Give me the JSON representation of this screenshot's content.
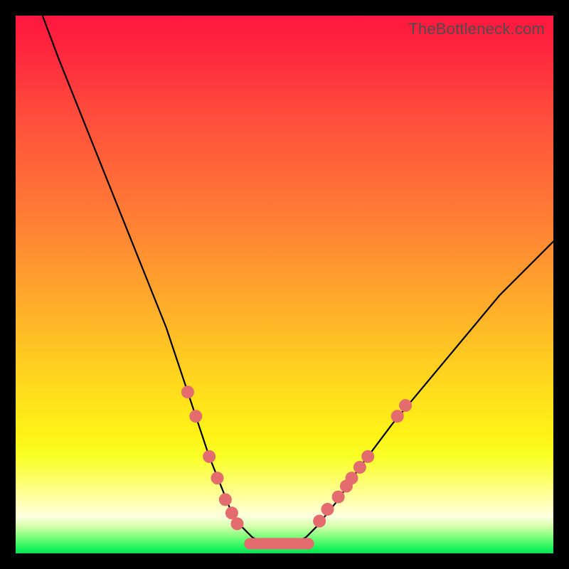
{
  "watermark": "TheBottleneck.com",
  "chart_data": {
    "type": "line",
    "title": "",
    "xlabel": "",
    "ylabel": "",
    "xlim": [
      0,
      100
    ],
    "ylim": [
      0,
      100
    ],
    "series": [
      {
        "name": "bottleneck-curve",
        "x": [
          5,
          8,
          12,
          16,
          20,
          24,
          28,
          30,
          32,
          34,
          36,
          38,
          40,
          42,
          44,
          46,
          48,
          50,
          52,
          54,
          56,
          60,
          64,
          70,
          80,
          90,
          100
        ],
        "y": [
          100,
          92,
          82,
          72,
          62,
          52,
          42,
          36,
          30,
          24,
          18,
          13,
          8,
          5,
          3,
          2,
          2,
          2,
          2,
          3,
          5,
          10,
          16,
          24,
          36,
          48,
          58
        ]
      }
    ],
    "markers": {
      "name": "highlight-dots",
      "color": "#e46b6e",
      "points": [
        {
          "x": 32.0,
          "y": 30.0
        },
        {
          "x": 33.5,
          "y": 25.5
        },
        {
          "x": 36.0,
          "y": 18.0
        },
        {
          "x": 37.5,
          "y": 14.0
        },
        {
          "x": 39.0,
          "y": 10.0
        },
        {
          "x": 40.2,
          "y": 7.5
        },
        {
          "x": 41.2,
          "y": 5.5
        },
        {
          "x": 56.5,
          "y": 6.0
        },
        {
          "x": 58.0,
          "y": 8.2
        },
        {
          "x": 60.0,
          "y": 10.5
        },
        {
          "x": 61.5,
          "y": 12.5
        },
        {
          "x": 62.5,
          "y": 14.0
        },
        {
          "x": 64.0,
          "y": 16.0
        },
        {
          "x": 65.5,
          "y": 18.0
        },
        {
          "x": 71.0,
          "y": 25.5
        },
        {
          "x": 72.5,
          "y": 27.5
        }
      ]
    },
    "flat_band": {
      "name": "bottom-pill",
      "color": "#e46b6e",
      "x0": 42.5,
      "x1": 55.5,
      "y": 1.8
    }
  }
}
